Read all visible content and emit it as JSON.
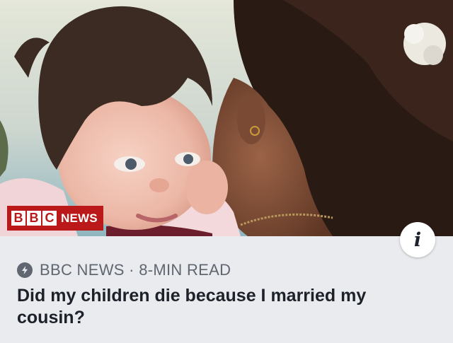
{
  "photo": {
    "subject": "child-with-woman-photo"
  },
  "logo": {
    "letters": [
      "B",
      "B",
      "C"
    ],
    "news_label": "NEWS",
    "color": "#bb1919"
  },
  "info_button": {
    "glyph": "i"
  },
  "meta": {
    "icon": "bolt-icon",
    "text": "BBC NEWS · 8-MIN READ"
  },
  "article": {
    "headline": "Did my children die because I married my cousin?"
  },
  "colors": {
    "card_background": "#e9ebee",
    "meta_text": "#606770",
    "headline_text": "#1d2129"
  }
}
